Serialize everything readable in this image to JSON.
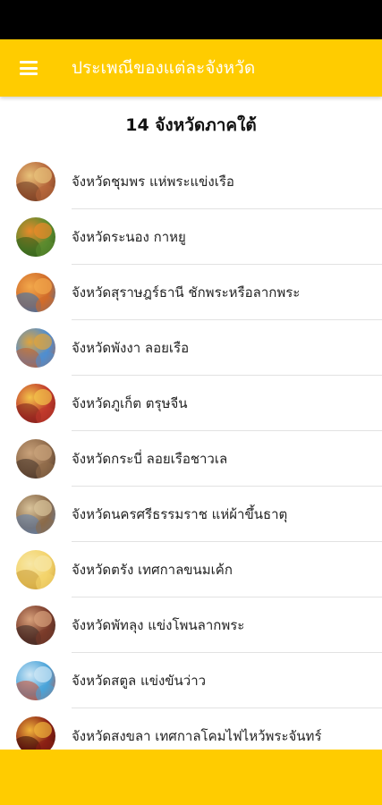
{
  "app_bar": {
    "title": "ประเพณีของแต่ละจังหวัด",
    "color": "#FFCC00",
    "menu_icon": "hamburger-menu-icon"
  },
  "section": {
    "title": "14 จังหวัดภาคใต้"
  },
  "items": [
    {
      "label": "จังหวัดชุมพร แห่พระแข่งเรือ",
      "colors": [
        "#b5653a",
        "#e8c27a",
        "#6b3b22"
      ]
    },
    {
      "label": "จังหวัดระนอง กาหยู",
      "colors": [
        "#5a8a2e",
        "#e98a2a",
        "#2f5a18"
      ]
    },
    {
      "label": "จังหวัดสุราษฎร์ธานี ชักพระหรือลากพระ",
      "colors": [
        "#d06b2a",
        "#f2a84b",
        "#2d6fb5"
      ]
    },
    {
      "label": "จังหวัดพังงา ลอยเรือ",
      "colors": [
        "#4f8ed1",
        "#e0a43c",
        "#c25b2a"
      ]
    },
    {
      "label": "จังหวัดภูเก็ต ตรุษจีน",
      "colors": [
        "#c0392b",
        "#f3c34a",
        "#7b1f1a"
      ]
    },
    {
      "label": "จังหวัดกระบี่ ลอยเรือชาวเล",
      "colors": [
        "#8f6a4a",
        "#c9a27a",
        "#3f2f26"
      ]
    },
    {
      "label": "จังหวัดนครศรีธรรมราช แห่ผ้าขึ้นธาตุ",
      "colors": [
        "#8a6a4a",
        "#d9c39a",
        "#5b7fb0"
      ]
    },
    {
      "label": "จังหวัดตรัง เทศกาลขนมเค้ก",
      "colors": [
        "#f3d36b",
        "#f7e7a6",
        "#c99a36"
      ]
    },
    {
      "label": "จังหวัดพัทลุง แข่งโพนลากพระ",
      "colors": [
        "#7a3b2a",
        "#d7a07a",
        "#3a2a26"
      ]
    },
    {
      "label": "จังหวัดสตูล แข่งขันว่าว",
      "colors": [
        "#4aa3d9",
        "#cfe7f5",
        "#d04a2a"
      ]
    },
    {
      "label": "จังหวัดสงขลา เทศกาลโคมไฟไหว้พระจันทร์",
      "colors": [
        "#8a1f14",
        "#f0b23a",
        "#3a0f0a"
      ]
    }
  ],
  "bottom_bar": {
    "color": "#FFCC00"
  }
}
